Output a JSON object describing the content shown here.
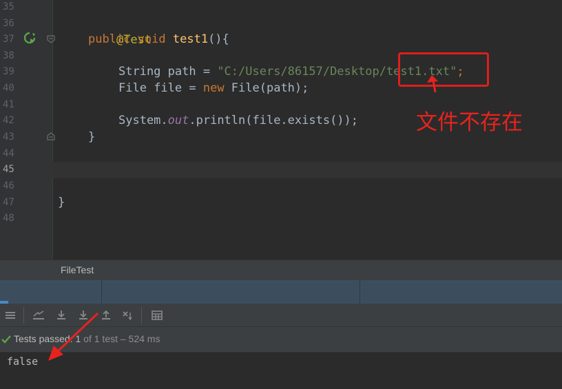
{
  "editor": {
    "line_numbers": [
      "35",
      "36",
      "37",
      "38",
      "39",
      "40",
      "41",
      "42",
      "43",
      "44",
      "45",
      "46",
      "47",
      "48"
    ],
    "current_line": "45",
    "lines": {
      "l36": {
        "annotation": "@Test"
      },
      "l37": {
        "kw1": "public",
        "kw2": "void",
        "method": "test1",
        "rest": "(){"
      },
      "l39": {
        "type": "String",
        "var": " path = ",
        "str": "\"C:/Users/86157/Desktop/test1.txt\"",
        "end": ";"
      },
      "l40": {
        "type": "File",
        "var": " file = ",
        "kw": "new",
        "ctor": " File(path);"
      },
      "l42": {
        "cls": "System.",
        "field": "out",
        "call": ".println(file.exists());"
      },
      "l43": {
        "brace": "}"
      },
      "l47": {
        "brace": "}"
      }
    }
  },
  "annotation": {
    "note": "文件不存在",
    "color": "#e8231d"
  },
  "file_tab": {
    "label": "FileTest"
  },
  "toolbar": {
    "icons": [
      "list-icon",
      "rerun-icon",
      "import-icon",
      "export-icon",
      "up-icon",
      "sort-icon",
      "grid-icon"
    ]
  },
  "test_status": {
    "prefix": "Tests passed: ",
    "count": "1",
    "suffix": " of 1 test – 524 ms"
  },
  "console": {
    "output": "false"
  },
  "colors": {
    "keyword": "#cc7832",
    "string": "#6a8759",
    "method": "#ffc66d",
    "annotation": "#bbb529",
    "static_field": "#9876aa",
    "pass": "#5ba54a"
  }
}
